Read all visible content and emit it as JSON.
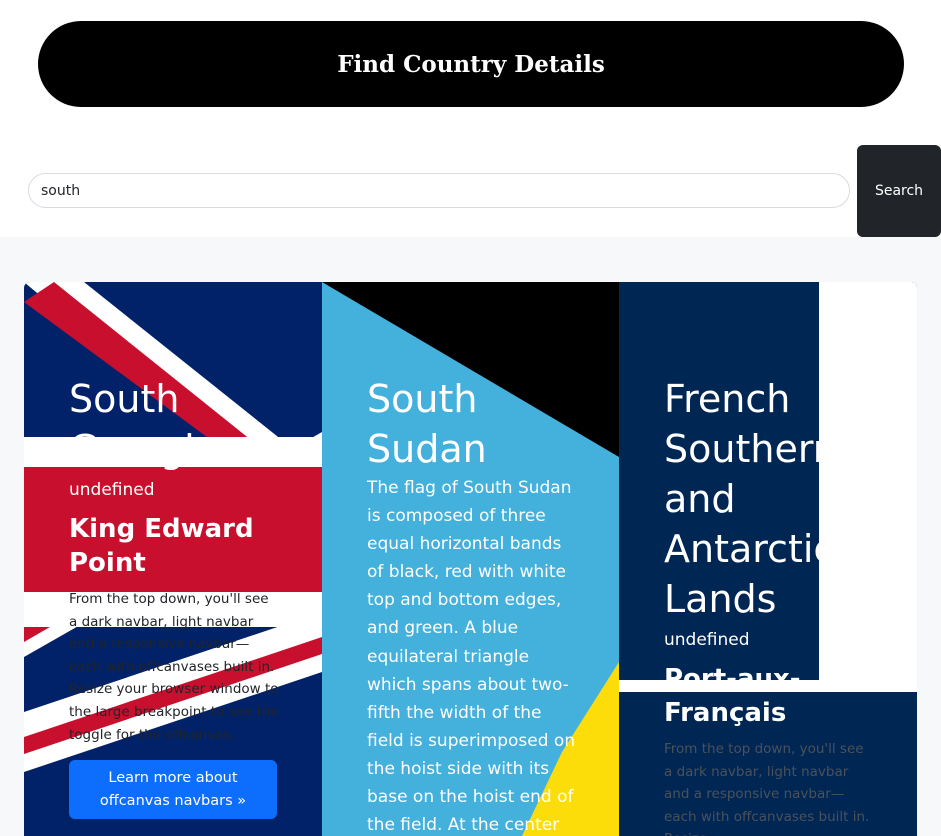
{
  "header": {
    "title": "Find Country Details"
  },
  "search": {
    "value": "south",
    "button_label": "Search"
  },
  "cards": [
    {
      "name": "South Georgia",
      "subtitle": "undefined",
      "capital": "King Edward Point",
      "description": "From the top down, you'll see a dark navbar, light navbar and a responsive navbar—each with offcanvases built in. Resize your browser window to the large breakpoint to see the toggle for the offcanvas.",
      "button_label": "Learn more about offcanvas navbars »",
      "flag": "union-jack-flag"
    },
    {
      "name": "South Sudan",
      "subtitle": "The flag of South Sudan is composed of three equal horizontal bands of black, red with white top and bottom edges, and green. A blue equilateral triangle which spans about two-fifth the width of the field is superimposed on the hoist side with its base on the hoist end of the field. At the center of",
      "flag": "south-sudan-flag"
    },
    {
      "name": "French Southern and Antarctic Lands",
      "subtitle": "undefined",
      "capital": "Port-aux-Français",
      "description": "From the top down, you'll see a dark navbar, light navbar and a responsive navbar—each with offcanvases built in. Resize",
      "flag": "french-southern-flag"
    }
  ],
  "colors": {
    "title_bg": "#000000",
    "search_button": "#212529",
    "primary": "#0d6efd",
    "flag_navy": "#012169",
    "flag_red": "#c8102e",
    "sudan_blue": "#44b0dc",
    "sudan_yellow": "#fcdd09",
    "fsal_navy": "#002654"
  }
}
